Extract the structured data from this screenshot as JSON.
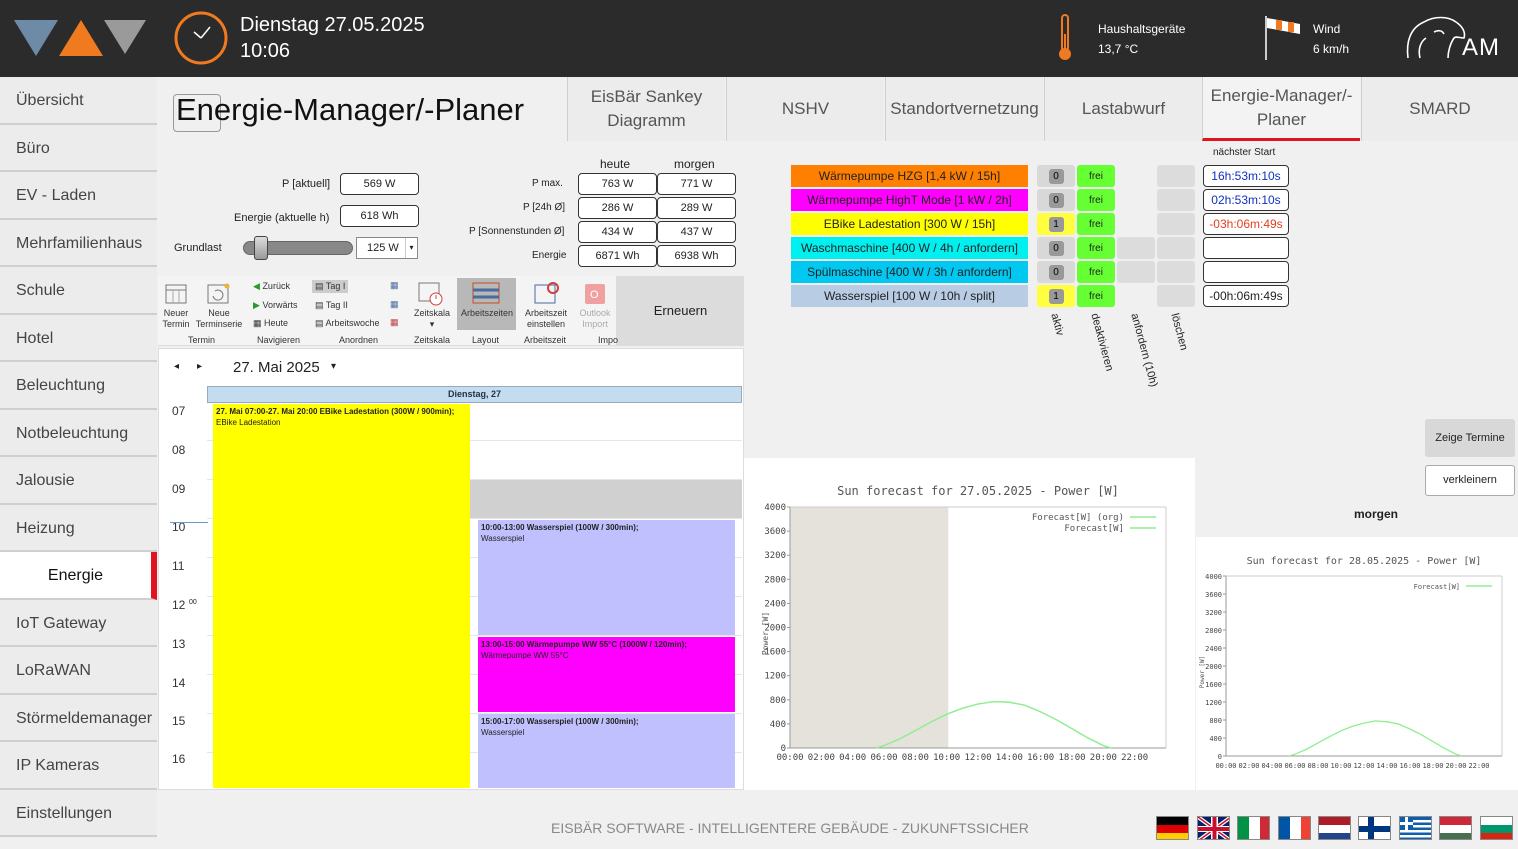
{
  "header": {
    "day": "Dienstag 27.05.2025",
    "time": "10:06",
    "appliances_label": "Haushaltsgeräte",
    "appliances_temp": "13,7 °C",
    "wind_label": "Wind",
    "wind_value": "6 km/h",
    "brand_short": "AM"
  },
  "sidebar": {
    "items": [
      {
        "label": "Übersicht"
      },
      {
        "label": "Büro"
      },
      {
        "label": "EV - Laden"
      },
      {
        "label": "Mehrfamilienhaus"
      },
      {
        "label": "Schule"
      },
      {
        "label": "Hotel"
      },
      {
        "label": "Beleuchtung"
      },
      {
        "label": "Notbeleuchtung"
      },
      {
        "label": "Jalousie"
      },
      {
        "label": "Heizung"
      },
      {
        "label": "Energie"
      },
      {
        "label": "IoT Gateway"
      },
      {
        "label": "LoRaWAN"
      },
      {
        "label": "Störmeldemanager"
      },
      {
        "label": "IP Kameras"
      },
      {
        "label": "Einstellungen"
      }
    ]
  },
  "page_title": "Energie-Manager/-Planer",
  "tabs": [
    {
      "label": "EisBär Sankey Diagramm"
    },
    {
      "label": "NSHV"
    },
    {
      "label": "Standortvernetzung"
    },
    {
      "label": "Lastabwurf"
    },
    {
      "label": "Energie-Manager/- Planer"
    },
    {
      "label": "SMARD"
    }
  ],
  "power": {
    "p_current_label": "P [aktuell]",
    "p_current": "569 W",
    "energy_label": "Energie (aktuelle h)",
    "energy": "618 Wh",
    "baseload_label": "Grundlast",
    "baseload_value": "125 W",
    "baseload_level": 0.1
  },
  "stats": {
    "col_today": "heute",
    "col_tomorrow": "morgen",
    "rows": [
      {
        "label": "P  max.",
        "today": "763 W",
        "tomorrow": "771 W"
      },
      {
        "label": "P [24h Ø]",
        "today": "286 W",
        "tomorrow": "289 W"
      },
      {
        "label": "P [Sonnenstunden Ø]",
        "today": "434 W",
        "tomorrow": "437 W"
      },
      {
        "label": "Energie",
        "today": "6871 Wh",
        "tomorrow": "6938 Wh"
      }
    ]
  },
  "devices": {
    "next_start_label": "nächster Start",
    "col_labels": [
      "aktiv",
      "deaktivieren",
      "anfordern (10h)",
      "löschen"
    ],
    "free_label": "frei",
    "items": [
      {
        "name": "Wärmepumpe HZG [1,4 kW / 15h]",
        "color": "#ff7f00",
        "active": "0",
        "next": "16h:53m:10s",
        "next_color": "#1030c0"
      },
      {
        "name": "Wärmepumpe HighT Mode [1 kW / 2h]",
        "color": "#ff00ff",
        "active": "0",
        "next": "02h:53m:10s",
        "next_color": "#1030c0"
      },
      {
        "name": "EBike Ladestation [300 W / 15h]",
        "color": "#ffff00",
        "active": "1",
        "next": "-03h:06m:49s",
        "next_color": "#e04020"
      },
      {
        "name": "Waschmaschine [400 W / 4h / anfordern]",
        "color": "#00f0f0",
        "active": "0",
        "next": "",
        "next_color": "#222222"
      },
      {
        "name": "Spülmaschine [400 W / 3h / anfordern]",
        "color": "#00c8f0",
        "active": "0",
        "next": "",
        "next_color": "#222222"
      },
      {
        "name": "Wasserspiel [100 W / 10h / split]",
        "color": "#b8cce4",
        "active": "1",
        "next": "-00h:06m:49s",
        "next_color": "#222222"
      }
    ]
  },
  "buttons": {
    "show_appointments": "Zeige Termine",
    "shrink": "verkleinern",
    "renew": "Erneuern"
  },
  "ribbon": {
    "new_appointment": "Neuer Termin",
    "new_series": "Neue Terminserie",
    "back": "Zurück",
    "forward": "Vorwärts",
    "today": "Heute",
    "day1": "Tag I",
    "day2": "Tag II",
    "workweek": "Arbeitswoche",
    "timescale": "Zeitskala",
    "worktimes": "Arbeitszeiten",
    "set_worktime": "Arbeitszeit einstellen",
    "outlook_import": "Outlook Import",
    "grp_appointment": "Termin",
    "grp_navigate": "Navigieren",
    "grp_arrange": "Anordnen",
    "grp_timescale": "Zeitskala",
    "grp_layout": "Layout",
    "grp_worktime": "Arbeitszeit",
    "grp_import": "Impo"
  },
  "calendar": {
    "date_label": "27. Mai 2025",
    "day_header": "Dienstag, 27",
    "hours": [
      "07",
      "08",
      "09",
      "10",
      "11",
      "12",
      "13",
      "14",
      "15",
      "16"
    ],
    "minute_suffix": "00",
    "appointments": [
      {
        "title": "27. Mai 07:00-27. Mai 20:00 EBike Ladestation (300W / 900min);",
        "subtitle": "EBike Ladestation",
        "color": "#ffff00"
      },
      {
        "title": "10:00-13:00 Wasserspiel (100W / 300min);",
        "subtitle": "Wasserspiel",
        "color": "#c0c0ff"
      },
      {
        "title": "13:00-15:00 Wärmepumpe WW 55°C (1000W / 120min);",
        "subtitle": "Wärmepumpe WW 55°C",
        "color": "#ff00ff"
      },
      {
        "title": "15:00-17:00 Wasserspiel (100W / 300min);",
        "subtitle": "Wasserspiel",
        "color": "#c0c0ff"
      }
    ]
  },
  "tomorrow_label": "morgen",
  "chart_data": [
    {
      "type": "line",
      "title": "Sun forecast for 27.05.2025 - Power [W]",
      "ylabel": "Power [W]",
      "xlabel": "",
      "x_ticks": [
        "00:00",
        "02:00",
        "04:00",
        "06:00",
        "08:00",
        "10:00",
        "12:00",
        "14:00",
        "16:00",
        "18:00",
        "20:00",
        "22:00"
      ],
      "y_ticks": [
        0,
        400,
        800,
        1200,
        1600,
        2000,
        2400,
        2800,
        3200,
        3600,
        4000
      ],
      "xlim": [
        0,
        24
      ],
      "ylim": [
        0,
        4000
      ],
      "legend": "top-right",
      "shaded_past_until": 10.1,
      "series": [
        {
          "name": "Forecast[W] (org)",
          "color": "#90ee90",
          "x": [
            5.5,
            6,
            7,
            8,
            9,
            10,
            11,
            12,
            13,
            14,
            15,
            16,
            17,
            18,
            19,
            20,
            20.5
          ],
          "y": [
            0,
            40,
            150,
            290,
            430,
            560,
            660,
            730,
            770,
            760,
            710,
            600,
            470,
            320,
            170,
            40,
            0
          ]
        },
        {
          "name": "Forecast[W]",
          "color": "#90ee90",
          "x": [
            5.5,
            6,
            7,
            8,
            9,
            10,
            11,
            12,
            13,
            14,
            15,
            16,
            17,
            18,
            19,
            20,
            20.5
          ],
          "y": [
            0,
            40,
            150,
            290,
            430,
            560,
            660,
            730,
            770,
            760,
            710,
            600,
            470,
            320,
            170,
            40,
            0
          ]
        }
      ]
    },
    {
      "type": "line",
      "title": "Sun forecast for 28.05.2025 - Power [W]",
      "ylabel": "Power [W]",
      "xlabel": "",
      "x_ticks": [
        "00:00",
        "02:00",
        "04:00",
        "06:00",
        "08:00",
        "10:00",
        "12:00",
        "14:00",
        "16:00",
        "18:00",
        "20:00",
        "22:00"
      ],
      "y_ticks": [
        0,
        400,
        800,
        1200,
        1600,
        2000,
        2400,
        2800,
        3200,
        3600,
        4000
      ],
      "xlim": [
        0,
        24
      ],
      "ylim": [
        0,
        4000
      ],
      "legend": "top-right",
      "series": [
        {
          "name": "Forecast[W]",
          "color": "#90ee90",
          "x": [
            5.5,
            6,
            7,
            8,
            9,
            10,
            11,
            12,
            13,
            14,
            15,
            16,
            17,
            18,
            19,
            20,
            20.5
          ],
          "y": [
            0,
            40,
            150,
            290,
            430,
            560,
            660,
            730,
            780,
            760,
            710,
            600,
            470,
            320,
            170,
            40,
            0
          ]
        }
      ]
    }
  ],
  "footer": {
    "tagline": "EISBÄR SOFTWARE - INTELLIGENTERE GEBÄUDE - ZUKUNFTSSICHER",
    "flags": [
      {
        "name": "flag-germany-icon"
      },
      {
        "name": "flag-uk-icon"
      },
      {
        "name": "flag-italy-icon"
      },
      {
        "name": "flag-france-icon"
      },
      {
        "name": "flag-netherlands-icon"
      },
      {
        "name": "flag-finland-icon"
      },
      {
        "name": "flag-greece-icon"
      },
      {
        "name": "flag-hungary-icon"
      },
      {
        "name": "flag-bulgaria-icon"
      }
    ]
  }
}
